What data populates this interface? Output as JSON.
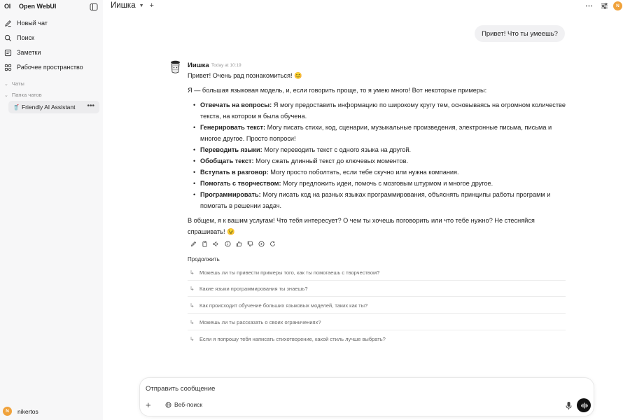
{
  "sidebar": {
    "logo": "OI",
    "brand": "Open WebUI",
    "nav": [
      {
        "label": "Новый чат",
        "icon": "edit-icon"
      },
      {
        "label": "Поиск",
        "icon": "search-icon"
      },
      {
        "label": "Заметки",
        "icon": "notes-icon"
      },
      {
        "label": "Рабочее пространство",
        "icon": "workspace-icon"
      }
    ],
    "sections": {
      "chats": "Чаты",
      "folder": "Папка чатов"
    },
    "chat_item": {
      "emoji": "🥤",
      "label": "Friendly AI Assistant"
    },
    "user": {
      "initial": "N",
      "name": "nikertos"
    }
  },
  "header": {
    "model": "Иишка",
    "avatar_initial": "N"
  },
  "user_message": "Привет! Что ты умеешь?",
  "assistant": {
    "name": "Иишка",
    "time": "Today at 10:19",
    "greeting": "Привет! Очень рад познакомиться! 😊",
    "intro": "Я — большая языковая модель, и, если говорить проще, то я умею много! Вот некоторые примеры:",
    "items": [
      {
        "title": "Отвечать на вопросы:",
        "text": " Я могу предоставить информацию по широкому кругу тем, основываясь на огромном количестве текста, на котором я была обучена."
      },
      {
        "title": "Генерировать текст:",
        "text": " Могу писать стихи, код, сценарии, музыкальные произведения, электронные письма, письма и многое другое. Просто попроси!"
      },
      {
        "title": "Переводить языки:",
        "text": " Могу переводить текст с одного языка на другой."
      },
      {
        "title": "Обобщать текст:",
        "text": " Могу сжать длинный текст до ключевых моментов."
      },
      {
        "title": "Вступать в разговор:",
        "text": " Могу просто поболтать, если тебе скучно или нужна компания."
      },
      {
        "title": "Помогать с творчеством:",
        "text": " Могу предложить идеи, помочь с мозговым штурмом и многое другое."
      },
      {
        "title": "Программировать:",
        "text": " Могу писать код на разных языках программирования, объяснять принципы работы программ и помогать в решении задач."
      }
    ],
    "outro": "В общем, я к вашим услугам! Что тебя интересует? О чем ты хочешь поговорить или что тебе нужно? Не стесняйся спрашивать! 😉"
  },
  "continue": {
    "title": "Продолжить",
    "suggestions": [
      "Можешь ли ты привести примеры того, как ты помогаешь с творчеством?",
      "Какие языки программирования ты знаешь?",
      "Как происходит обучение больших языковых моделей, таких как ты?",
      "Можешь ли ты рассказать о своих ограничениях?",
      "Если я попрошу тебя написать стихотворение, какой стиль лучше выбрать?"
    ]
  },
  "composer": {
    "placeholder": "Отправить сообщение",
    "web_search": "Веб-поиск"
  }
}
